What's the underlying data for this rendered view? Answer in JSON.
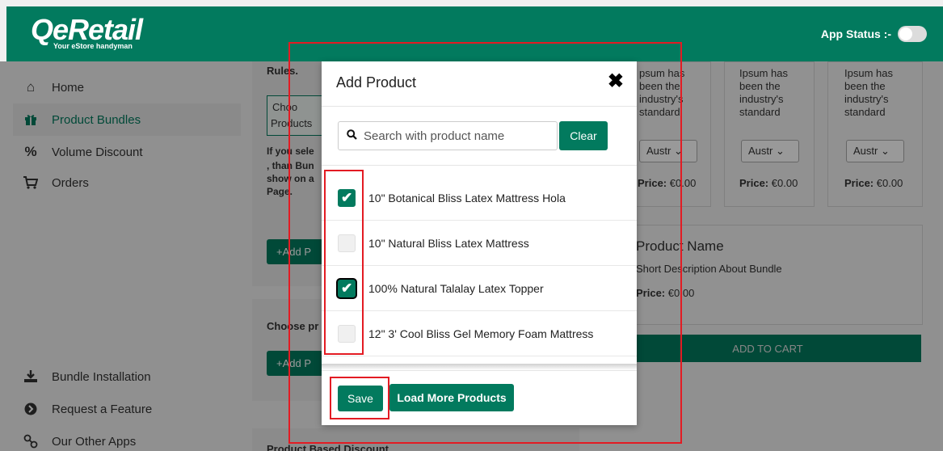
{
  "header": {
    "logo_main": "QeRetail",
    "logo_sub": "Your eStore handyman",
    "app_status_label": "App Status :-"
  },
  "sidebar": {
    "items": [
      {
        "label": "Home",
        "icon": "home-icon"
      },
      {
        "label": "Product Bundles",
        "icon": "gift-icon"
      },
      {
        "label": "Volume Discount",
        "icon": "percent-icon"
      },
      {
        "label": "Orders",
        "icon": "cart-icon"
      }
    ],
    "bottom_items": [
      {
        "label": "Bundle Installation",
        "icon": "download-icon"
      },
      {
        "label": "Request a Feature",
        "icon": "arrow-circle-icon"
      },
      {
        "label": "Our Other Apps",
        "icon": "link-icon"
      }
    ]
  },
  "background": {
    "rules_label": "Rules.",
    "choose_label": "Choo",
    "products_label": "Products",
    "if_you_sele": "If you sele",
    "then_bun": ", than Bun",
    "show_on_a": "show on a",
    "page": "Page.",
    "add_btn": "Add P",
    "choose_pr": "Choose pr",
    "add_btn2": "Add P",
    "product_based_discount": "Product Based Discount",
    "card_text_1": "psum has",
    "card_text_2": "been the",
    "card_text_3": "industry's",
    "card_text_4": "standard",
    "card_ipsum": "Ipsum has",
    "card_been": "been the",
    "card_industry": "industry's",
    "card_standard": "standard",
    "select_value": "Austr",
    "price_label": "Price:",
    "price_value": "€0.00",
    "product_name": "Product Name",
    "short_desc": "Short Description About Bundle",
    "add_to_cart": "ADD TO CART"
  },
  "modal": {
    "title": "Add Product",
    "search_placeholder": "Search with product name",
    "clear_label": "Clear",
    "products": [
      {
        "name": "10\" Botanical Bliss Latex Mattress Hola",
        "checked": true
      },
      {
        "name": "10\" Natural Bliss Latex Mattress",
        "checked": false
      },
      {
        "name": "100% Natural Talalay Latex Topper",
        "checked": true
      },
      {
        "name": "12\" 3' Cool Bliss Gel Memory Foam Mattress",
        "checked": false
      }
    ],
    "save_label": "Save",
    "load_more_label": "Load More Products"
  },
  "colors": {
    "brand": "#027a5e",
    "annotation": "#e31b23"
  }
}
